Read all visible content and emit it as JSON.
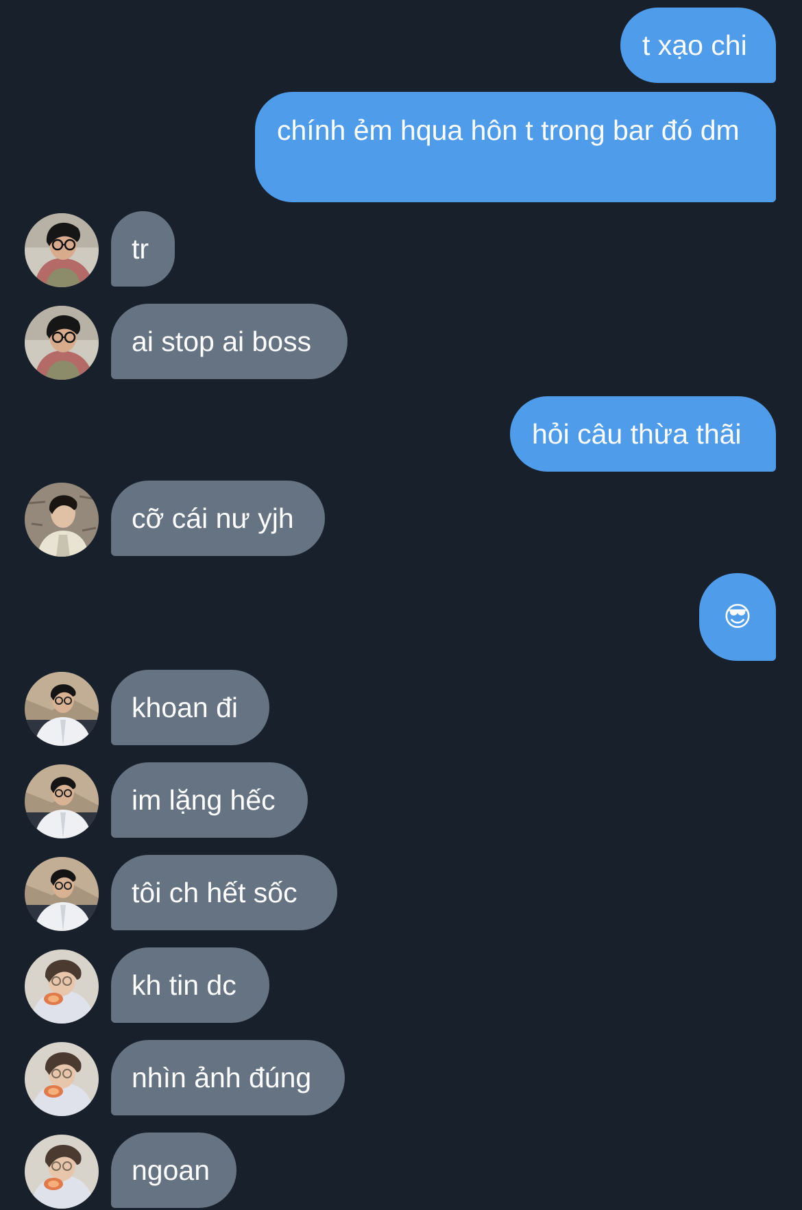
{
  "messages": {
    "m1": "t xạo chi",
    "m2": "chính ẻm hqua hôn t trong bar đó dm",
    "m3": "tr",
    "m4": "ai stop ai boss",
    "m5": "hỏi câu thừa thãi",
    "m6": "cỡ cái nư yjh",
    "m7": "😎",
    "m8": "khoan đi",
    "m9": "im lặng hếc",
    "m10": "tôi ch hết sốc",
    "m11": "kh tin dc",
    "m12": "nhìn ảnh đúng",
    "m13": "ngoan"
  },
  "colors": {
    "background": "#18202b",
    "outgoing_bubble": "#4f9ceb",
    "incoming_bubble": "#657382",
    "text": "#ffffff"
  }
}
